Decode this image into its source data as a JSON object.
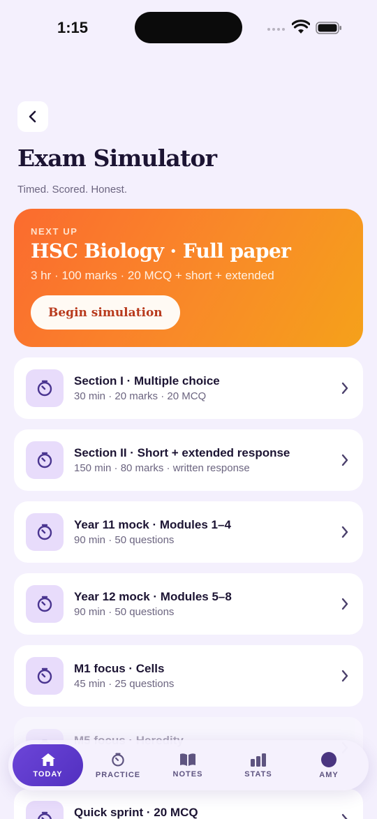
{
  "status_bar": {
    "time": "1:15"
  },
  "header": {
    "title": "Exam Simulator",
    "subtitle": "Timed. Scored. Honest."
  },
  "hero": {
    "eyebrow": "NEXT UP",
    "title": "HSC Biology · Full paper",
    "meta": "3 hr · 100 marks · 20 MCQ + short + extended",
    "button_label": "Begin simulation"
  },
  "exams": [
    {
      "title": "Section I · Multiple choice",
      "meta": "30 min · 20 marks · 20 MCQ"
    },
    {
      "title": "Section II · Short + extended response",
      "meta": "150 min · 80 marks · written response"
    },
    {
      "title": "Year 11 mock · Modules 1–4",
      "meta": "90 min · 50 questions"
    },
    {
      "title": "Year 12 mock · Modules 5–8",
      "meta": "90 min · 50 questions"
    },
    {
      "title": "M1 focus · Cells",
      "meta": "45 min · 25 questions"
    },
    {
      "title": "M5 focus · Heredity",
      "meta": ""
    },
    {
      "title": "Quick sprint · 20 MCQ",
      "meta": ""
    }
  ],
  "tabbar": {
    "tabs": [
      {
        "label": "TODAY",
        "icon": "home-icon"
      },
      {
        "label": "PRACTICE",
        "icon": "timer-icon"
      },
      {
        "label": "NOTES",
        "icon": "book-icon"
      },
      {
        "label": "STATS",
        "icon": "bar-chart-icon"
      },
      {
        "label": "AMY",
        "icon": "avatar"
      }
    ]
  },
  "colors": {
    "background": "#f4f0fd",
    "accent_purple": "#6c45d8",
    "hero_orange": "#fb6b2f",
    "icon_tile": "#e8dcfb"
  }
}
